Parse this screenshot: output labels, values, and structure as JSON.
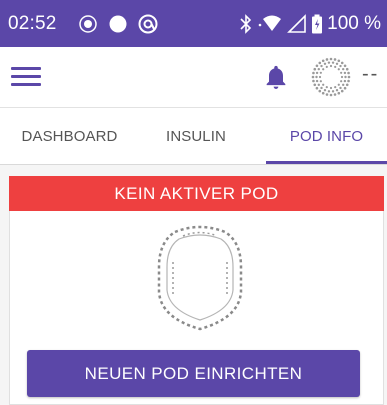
{
  "colors": {
    "brand": "#5b47a8",
    "alert": "#ee4040",
    "text": "#555555",
    "background": "#f5f5f5"
  },
  "status_bar": {
    "time": "02:52",
    "battery_percent": "100 %",
    "icons": [
      "notification-dot-icon",
      "circle-icon",
      "app-sync-icon",
      "bluetooth-icon",
      "wifi-icon",
      "signal-icon",
      "battery-icon"
    ]
  },
  "app_bar": {
    "menu_icon": "hamburger-menu-icon",
    "bell_icon": "bell-icon",
    "status_placeholder": "--"
  },
  "tabs": [
    {
      "label": "DASHBOARD",
      "active": false
    },
    {
      "label": "INSULIN",
      "active": false
    },
    {
      "label": "POD INFO",
      "active": true
    }
  ],
  "pod_info": {
    "banner_text": "KEIN AKTIVER POD",
    "setup_button_label": "NEUEN POD EINRICHTEN",
    "illustration": "pod-outline-icon"
  }
}
